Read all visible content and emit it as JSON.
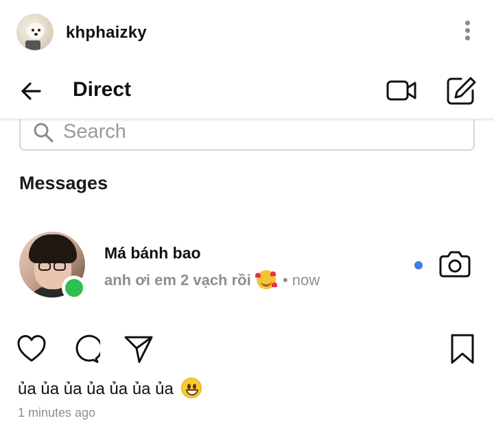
{
  "post": {
    "username": "khphaizky",
    "caption_text": "ủa ủa ủa ủa ủa ủa ủa",
    "caption_emoji": "grinning-face-emoji",
    "timestamp": "1 minutes ago"
  },
  "direct": {
    "title": "Direct",
    "search_placeholder": "Search",
    "messages_label": "Messages",
    "conversation": {
      "name": "Má bánh bao",
      "last_message": "anh ơi em 2 vạch rồi",
      "last_message_emoji": "smiling-face-with-hearts-emoji",
      "time": " • now",
      "online": true,
      "unread": true
    }
  },
  "icons": {
    "back": "back-arrow-icon",
    "video": "video-call-icon",
    "compose": "compose-icon",
    "search": "search-icon",
    "camera": "camera-icon",
    "like": "heart-icon",
    "comment": "comment-icon",
    "share": "share-icon",
    "bookmark": "bookmark-icon",
    "more": "more-vertical-icon"
  },
  "colors": {
    "online": "#2dbf4f",
    "unread": "#3b7ee8",
    "muted_text": "#8e8e8e"
  }
}
